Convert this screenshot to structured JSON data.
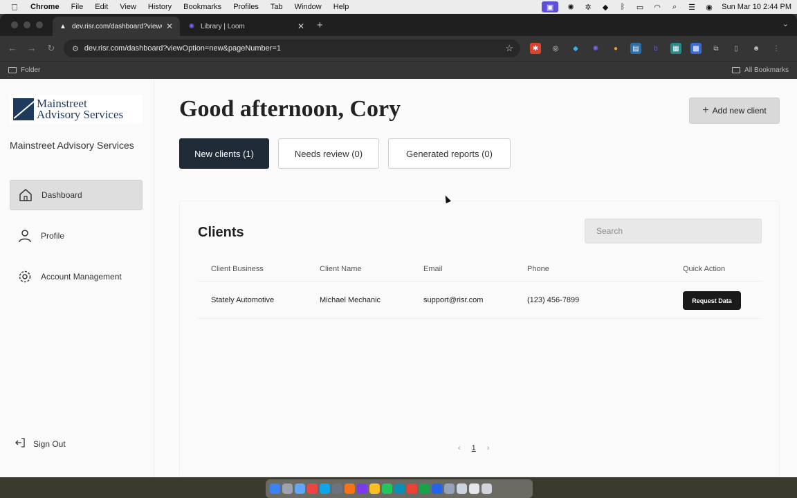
{
  "menubar": {
    "app_name": "Chrome",
    "items": [
      "File",
      "Edit",
      "View",
      "History",
      "Bookmarks",
      "Profiles",
      "Tab",
      "Window",
      "Help"
    ],
    "clock": "Sun Mar 10  2:44 PM"
  },
  "browser": {
    "tabs": [
      {
        "title": "dev.risr.com/dashboard?viewO",
        "active": true
      },
      {
        "title": "Library | Loom",
        "active": false
      }
    ],
    "url": "dev.risr.com/dashboard?viewOption=new&pageNumber=1",
    "bookmarks": {
      "folder": "Folder",
      "all": "All Bookmarks"
    }
  },
  "sidebar": {
    "logo_text": [
      "Mainstreet",
      "Advisory Services"
    ],
    "org_name": "Mainstreet Advisory Services",
    "nav": [
      {
        "label": "Dashboard",
        "icon": "home-icon",
        "active": true
      },
      {
        "label": "Profile",
        "icon": "user-icon",
        "active": false
      },
      {
        "label": "Account Management",
        "icon": "gear-icon",
        "active": false
      }
    ],
    "sign_out": "Sign Out"
  },
  "main": {
    "greeting": "Good afternoon, Cory",
    "add_client_label": "Add new client",
    "filter_tabs": [
      {
        "label": "New clients (1)",
        "selected": true
      },
      {
        "label": "Needs review (0)",
        "selected": false
      },
      {
        "label": "Generated reports (0)",
        "selected": false
      }
    ],
    "clients": {
      "title": "Clients",
      "search_placeholder": "Search",
      "columns": [
        "Client Business",
        "Client Name",
        "Email",
        "Phone",
        "Quick Action"
      ],
      "rows": [
        {
          "business": "Stately Automotive",
          "name": "Michael Mechanic",
          "email": "support@risr.com",
          "phone": "(123) 456-7899",
          "action": "Request Data"
        }
      ],
      "pager": {
        "prev": "‹",
        "current": "1",
        "next": "›"
      }
    }
  },
  "colors": {
    "brand_navy": "#1e3a5c",
    "selected_tab": "#1e2a35",
    "action_button": "#1a1a1a"
  }
}
